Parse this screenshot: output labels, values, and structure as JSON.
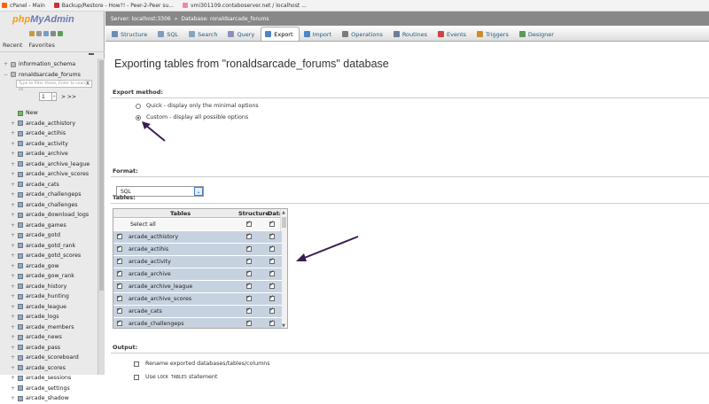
{
  "bookmarks": [
    {
      "label": "cPanel - Main",
      "icon": "cpanel-icon",
      "color": "#f60"
    },
    {
      "label": "Backup/Restore - How?! - Peer-2-Peer su...",
      "icon": "forum-icon",
      "color": "#c33"
    },
    {
      "label": "vmi301109.contaboserver.net / localhost ...",
      "icon": "pma-icon",
      "color": "#e8a"
    }
  ],
  "nav": {
    "logo_php": "php",
    "logo_myadmin": "MyAdmin",
    "tabs": [
      "Recent",
      "Favorites"
    ],
    "filter_placeholder": "Type to filter these, Enter to search all",
    "filter_clear": "X",
    "pager_value": "1",
    "pager_next": "> >>",
    "databases": [
      "information_schema",
      "ronaldsarcade_forums"
    ],
    "new_label": "New",
    "tables": [
      "arcade_acthistory",
      "arcade_actihis",
      "arcade_activity",
      "arcade_archive",
      "arcade_archive_league",
      "arcade_archive_scores",
      "arcade_cats",
      "arcade_challengeps",
      "arcade_challenges",
      "arcade_download_logs",
      "arcade_games",
      "arcade_gotd",
      "arcade_gotd_rank",
      "arcade_gotd_scores",
      "arcade_gow",
      "arcade_gow_rank",
      "arcade_history",
      "arcade_hunting",
      "arcade_league",
      "arcade_logs",
      "arcade_members",
      "arcade_news",
      "arcade_pass",
      "arcade_scoreboard",
      "arcade_scores",
      "arcade_sessions",
      "arcade_settings",
      "arcade_shadow"
    ]
  },
  "breadcrumb": {
    "server": "Server: localhost:3306",
    "sep": "»",
    "database": "Database: ronaldsarcade_forums"
  },
  "tabs": [
    {
      "label": "Structure",
      "icon": "structure-icon",
      "color": "#6b8db5"
    },
    {
      "label": "SQL",
      "icon": "sql-icon",
      "color": "#7f9cc0"
    },
    {
      "label": "Search",
      "icon": "search-icon",
      "color": "#8aa3c4"
    },
    {
      "label": "Query",
      "icon": "query-icon",
      "color": "#8f8fbf"
    },
    {
      "label": "Export",
      "icon": "export-icon",
      "color": "#4d86c7",
      "active": true
    },
    {
      "label": "Import",
      "icon": "import-icon",
      "color": "#4d86c7"
    },
    {
      "label": "Operations",
      "icon": "wrench-icon",
      "color": "#7b7b7b"
    },
    {
      "label": "Routines",
      "icon": "routines-icon",
      "color": "#6d7f99"
    },
    {
      "label": "Events",
      "icon": "events-icon",
      "color": "#c44"
    },
    {
      "label": "Triggers",
      "icon": "triggers-icon",
      "color": "#c98d2c"
    },
    {
      "label": "Designer",
      "icon": "designer-icon",
      "color": "#5a9a5a"
    }
  ],
  "page": {
    "title": "Exporting tables from \"ronaldsarcade_forums\" database",
    "export_method_label": "Export method:",
    "method_quick": "Quick - display only the minimal options",
    "method_custom": "Custom - display all possible options",
    "method_selected": "custom",
    "format_label": "Format:",
    "format_value": "SQL",
    "tables_label": "Tables:",
    "col_tables": "Tables",
    "col_structure": "Structure",
    "col_data": "Data",
    "select_all": "Select all",
    "export_tables": [
      "arcade_acthistory",
      "arcade_actihis",
      "arcade_activity",
      "arcade_archive",
      "arcade_archive_league",
      "arcade_archive_scores",
      "arcade_cats",
      "arcade_challengeps"
    ],
    "output_label": "Output:",
    "opt_rename": "Rename exported databases/tables/columns",
    "opt_lock_pre": "Use ",
    "opt_lock_code": "LOCK TABLES",
    "opt_lock_post": " statement"
  },
  "colors": {
    "arrow": "#3b1f4f",
    "selected_row": "#c7d2e0",
    "breadcrumb": "#888888"
  }
}
